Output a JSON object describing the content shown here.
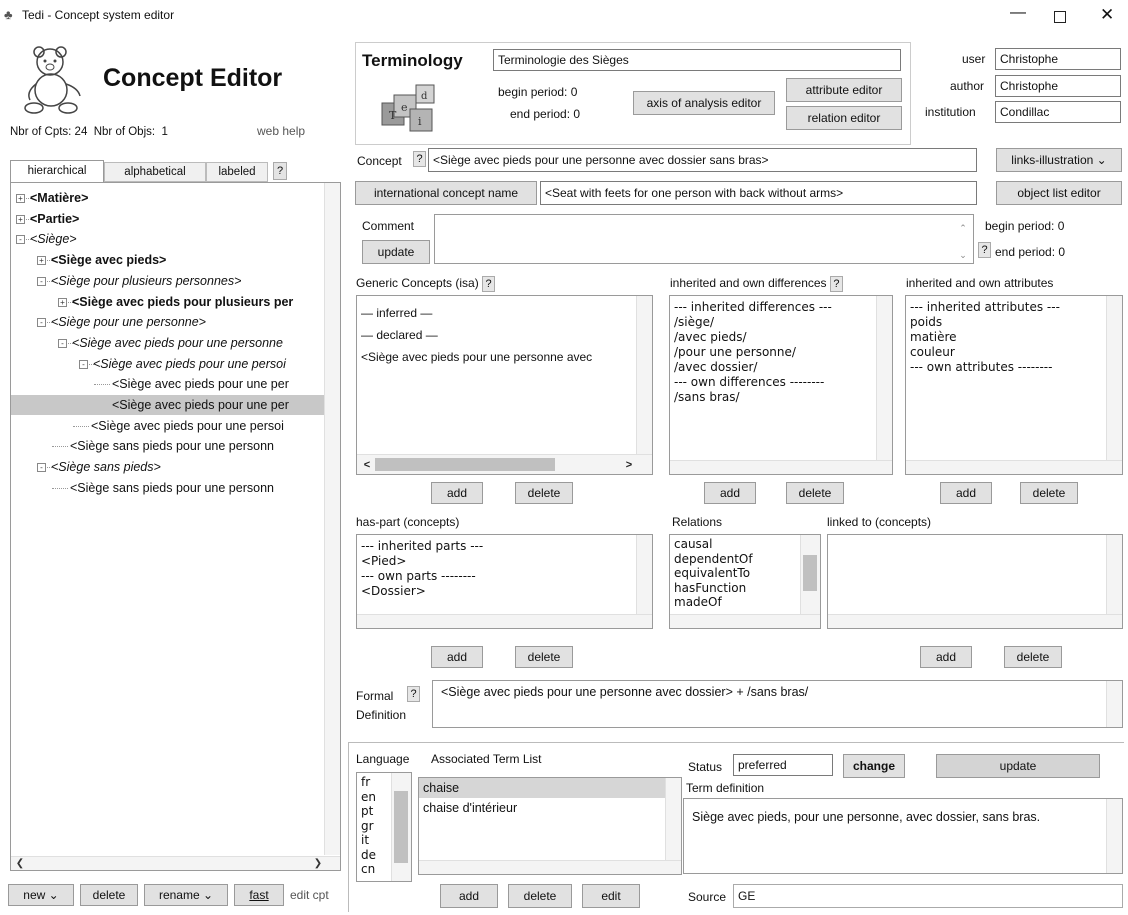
{
  "window": {
    "title": "Tedi - Concept system editor"
  },
  "app": {
    "heading": "Concept Editor",
    "counts": "Nbr of Cpts: 24  Nbr of Objs:  1",
    "web_help": "web help"
  },
  "tabs": [
    "hierarchical",
    "alphabetical",
    "labeled",
    "?"
  ],
  "tree": [
    {
      "text": "<Matière>",
      "indent": 0,
      "bold": true,
      "italic": false,
      "expander": "+"
    },
    {
      "text": "<Partie>",
      "indent": 0,
      "bold": true,
      "italic": false,
      "expander": "+"
    },
    {
      "text": "<Siège>",
      "indent": 0,
      "bold": false,
      "italic": true,
      "expander": "-"
    },
    {
      "text": "<Siège avec pieds>",
      "indent": 1,
      "bold": true,
      "italic": false,
      "expander": "+"
    },
    {
      "text": "<Siège pour plusieurs personnes>",
      "indent": 1,
      "bold": false,
      "italic": true,
      "expander": "-"
    },
    {
      "text": "<Siège avec pieds pour plusieurs per",
      "indent": 2,
      "bold": true,
      "italic": false,
      "expander": "+"
    },
    {
      "text": "<Siège pour une personne>",
      "indent": 1,
      "bold": false,
      "italic": true,
      "expander": "-"
    },
    {
      "text": "<Siège avec pieds pour une personne",
      "indent": 2,
      "bold": false,
      "italic": true,
      "expander": "-"
    },
    {
      "text": "<Siège avec pieds pour une persoi",
      "indent": 3,
      "bold": false,
      "italic": true,
      "expander": "-"
    },
    {
      "text": "<Siège avec pieds pour une per",
      "indent": 4,
      "bold": false,
      "italic": false,
      "expander": ""
    },
    {
      "text": "<Siège avec pieds pour une per",
      "indent": 4,
      "bold": false,
      "italic": false,
      "expander": "",
      "selected": true
    },
    {
      "text": "<Siège avec pieds pour une persoi",
      "indent": 3,
      "bold": false,
      "italic": false,
      "expander": ""
    },
    {
      "text": "<Siège sans pieds pour une personn",
      "indent": 2,
      "bold": false,
      "italic": false,
      "expander": ""
    },
    {
      "text": "<Siège sans pieds>",
      "indent": 1,
      "bold": false,
      "italic": true,
      "expander": "-"
    },
    {
      "text": "<Siège sans pieds pour une personn",
      "indent": 2,
      "bold": false,
      "italic": false,
      "expander": ""
    }
  ],
  "bottom_left": {
    "new": "new",
    "delete": "delete",
    "rename": "rename",
    "fast": "fast",
    "edit_cpt": "edit cpt"
  },
  "terminology": {
    "label": "Terminology",
    "value": "Terminologie des Sièges",
    "begin_label": "begin period:",
    "begin_value": "0",
    "end_label": "end period:",
    "end_value": "0",
    "axis_button": "axis of analysis editor",
    "attribute_button": "attribute editor",
    "relation_button": "relation editor"
  },
  "user_info": {
    "user_label": "user",
    "user": "Christophe",
    "author_label": "author",
    "author": "Christophe",
    "institution_label": "institution",
    "institution": "Condillac"
  },
  "concept": {
    "label": "Concept",
    "q": "?",
    "value": "<Siège avec pieds pour une personne avec dossier sans bras>",
    "links_select": "links-illustration",
    "intl_button": "international concept name",
    "intl_value": "<Seat with feets for one person with back without arms>",
    "object_list_button": "object list editor",
    "comment_label": "Comment",
    "update": "update",
    "begin_label": "begin period:",
    "begin_value": "0",
    "end_label": "end period:",
    "end_value": "0"
  },
  "generic": {
    "title": "Generic Concepts (isa)",
    "lines": [
      "— inferred —",
      "— declared —",
      "<Siège avec pieds pour une personne avec"
    ],
    "add": "add",
    "delete": "delete"
  },
  "differences": {
    "title": "inherited and own differences",
    "lines": [
      "--- inherited differences ---",
      "/siège/",
      "/avec pieds/",
      "/pour une personne/",
      "/avec dossier/",
      "--- own differences --------",
      "/sans bras/"
    ],
    "add": "add",
    "delete": "delete"
  },
  "attributes": {
    "title": "inherited and own attributes",
    "lines": [
      "--- inherited attributes ---",
      "poids",
      "matière",
      "couleur",
      "--- own attributes --------"
    ],
    "add": "add",
    "delete": "delete"
  },
  "has_part": {
    "title": "has-part (concepts)",
    "lines": [
      "--- inherited parts ---",
      "<Pied>",
      "--- own parts --------",
      "<Dossier>"
    ],
    "add": "add",
    "delete": "delete"
  },
  "relations": {
    "title": "Relations",
    "lines": [
      "causal",
      "dependentOf",
      "equivalentTo",
      "hasFunction",
      "madeOf"
    ]
  },
  "linked": {
    "title": "linked to (concepts)",
    "add": "add",
    "delete": "delete"
  },
  "formal": {
    "label1": "Formal",
    "q": "?",
    "label2": "Definition",
    "value": "<Siège avec pieds pour une personne avec dossier> + /sans bras/"
  },
  "terms": {
    "language_label": "Language",
    "list_label": "Associated Term List",
    "languages": [
      "fr",
      "en",
      "pt",
      "gr",
      "it",
      "de",
      "cn"
    ],
    "term_lines": [
      "chaise",
      "chaise d'intérieur"
    ],
    "add": "add",
    "delete": "delete",
    "edit": "edit",
    "status_label": "Status",
    "status_value": "preferred",
    "change": "change",
    "update": "update",
    "term_def_label": "Term definition",
    "term_def": "Siège avec pieds, pour une personne, avec dossier, sans bras.",
    "source_label": "Source",
    "source_value": "GE"
  },
  "colors": {
    "selected_row": "#c8c8c8",
    "button_bg": "#e1e1e1",
    "update_bg": "#d4d4d4"
  }
}
